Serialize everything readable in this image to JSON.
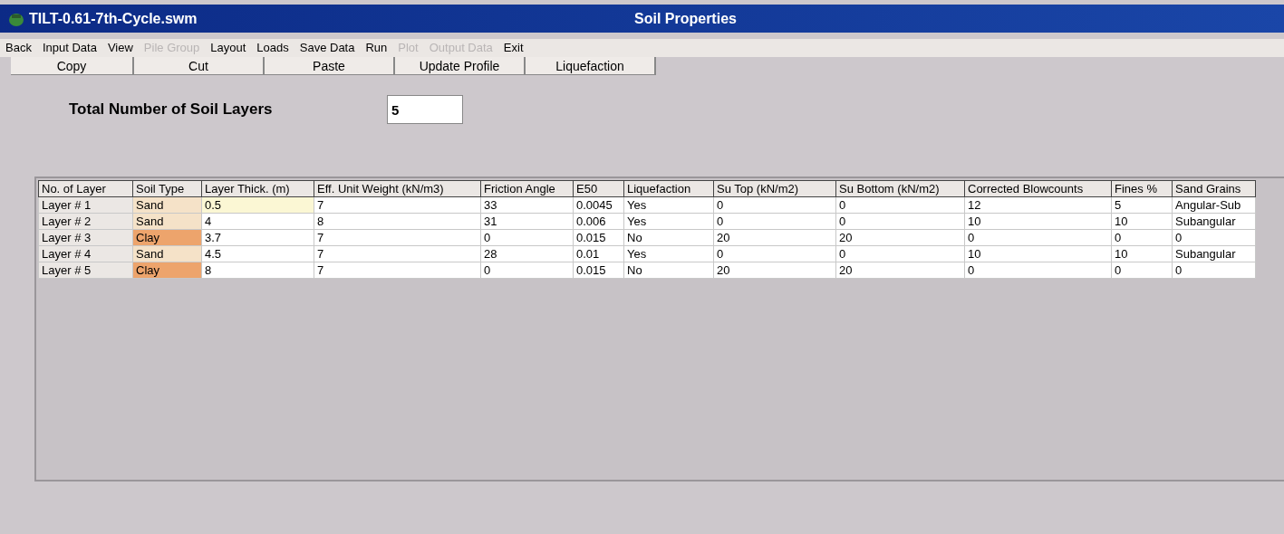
{
  "window": {
    "file_title": "TILT-0.61-7th-Cycle.swm",
    "title": "Soil Properties"
  },
  "menu": [
    {
      "label": "Back",
      "disabled": false
    },
    {
      "label": "Input Data",
      "disabled": false
    },
    {
      "label": "View",
      "disabled": false
    },
    {
      "label": "Pile Group",
      "disabled": true
    },
    {
      "label": "Layout",
      "disabled": false
    },
    {
      "label": "Loads",
      "disabled": false
    },
    {
      "label": "Save Data",
      "disabled": false
    },
    {
      "label": "Run",
      "disabled": false
    },
    {
      "label": "Plot",
      "disabled": true
    },
    {
      "label": "Output Data",
      "disabled": true
    },
    {
      "label": "Exit",
      "disabled": false
    }
  ],
  "toolbar": [
    "Copy",
    "Cut",
    "Paste",
    "Update Profile",
    "Liquefaction"
  ],
  "layers_field": {
    "label": "Total Number of Soil Layers",
    "value": "5"
  },
  "table": {
    "columns": [
      "No. of  Layer",
      "Soil Type",
      "Layer Thick. (m)",
      "Eff. Unit Weight (kN/m3)",
      "Friction Angle",
      "E50",
      "Liquefaction",
      "Su Top (kN/m2)",
      "Su Bottom (kN/m2)",
      "Corrected Blowcounts",
      "Fines %",
      "Sand Grains"
    ],
    "rows": [
      {
        "cells": [
          "Layer # 1",
          "Sand",
          "0.5",
          "7",
          "33",
          "0.0045",
          "Yes",
          "0",
          "0",
          "12",
          "5",
          "Angular-Sub"
        ],
        "color": "#f5e2c8",
        "selected": true
      },
      {
        "cells": [
          "Layer # 2",
          "Sand",
          "4",
          "8",
          "31",
          "0.006",
          "Yes",
          "0",
          "0",
          "10",
          "10",
          "Subangular"
        ],
        "color": "#f5e2c8",
        "selected": false
      },
      {
        "cells": [
          "Layer # 3",
          "Clay",
          "3.7",
          "7",
          "0",
          "0.015",
          "No",
          "20",
          "20",
          "0",
          "0",
          "0"
        ],
        "color": "#eda46c",
        "selected": false
      },
      {
        "cells": [
          "Layer # 4",
          "Sand",
          "4.5",
          "7",
          "28",
          "0.01",
          "Yes",
          "0",
          "0",
          "10",
          "10",
          "Subangular"
        ],
        "color": "#f5e2c8",
        "selected": false
      },
      {
        "cells": [
          "Layer # 5",
          "Clay",
          "8",
          "7",
          "0",
          "0.015",
          "No",
          "20",
          "20",
          "0",
          "0",
          "0"
        ],
        "color": "#eda46c",
        "selected": false
      }
    ]
  }
}
